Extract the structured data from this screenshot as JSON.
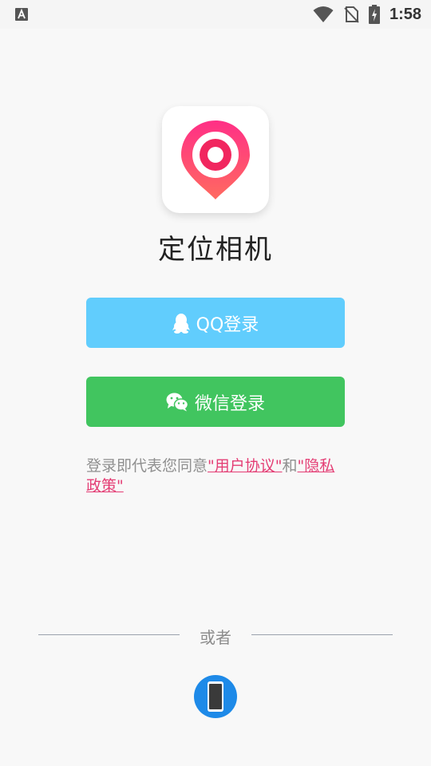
{
  "status_bar": {
    "time": "1:58",
    "icons": [
      "a-notification-icon",
      "wifi-icon",
      "no-sim-icon",
      "battery-charging-icon"
    ]
  },
  "app": {
    "title": "定位相机",
    "icon": "location-pin-icon",
    "brand_colors": [
      "#ff3f7e",
      "#ff6b6b"
    ]
  },
  "buttons": {
    "qq_label": "QQ登录",
    "qq_icon": "qq-penguin-icon",
    "qq_color": "#61cdfd",
    "wechat_label": "微信登录",
    "wechat_icon": "wechat-icon",
    "wechat_color": "#41c55f"
  },
  "agreement": {
    "prefix": "登录即代表您同意",
    "user_agreement": "\"用户协议\"",
    "and": "和",
    "privacy_policy": "\"隐私政策\""
  },
  "divider": {
    "label": "或者"
  },
  "phone_login": {
    "icon": "phone-icon",
    "color": "#1e8ae8"
  }
}
